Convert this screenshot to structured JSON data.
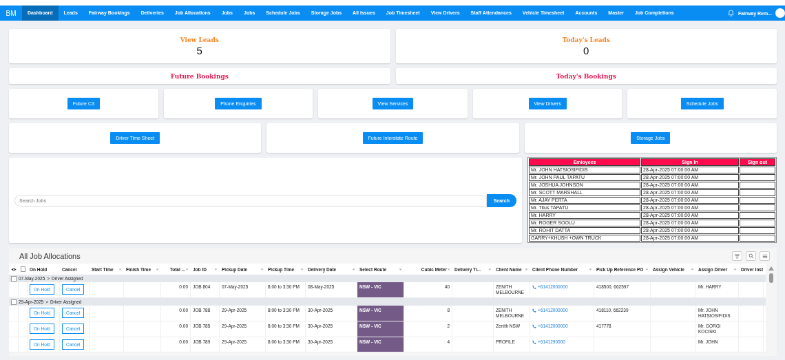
{
  "nav": {
    "brand": "BM",
    "user": "Fairway Rem...",
    "items": [
      {
        "label": "Dashboard",
        "selected": true
      },
      {
        "label": "Leads",
        "selected": false
      },
      {
        "label": "Fairway Bookings",
        "selected": false
      },
      {
        "label": "Deliveries",
        "selected": false
      },
      {
        "label": "Job Allocations",
        "selected": false
      },
      {
        "label": "Jobs",
        "selected": false
      },
      {
        "label": "Jobs",
        "selected": false
      },
      {
        "label": "Schedule Jobs",
        "selected": false
      },
      {
        "label": "Storage Jobs",
        "selected": false
      },
      {
        "label": "All Issues",
        "selected": false
      },
      {
        "label": "Job Timesheet",
        "selected": false
      },
      {
        "label": "View Drivers",
        "selected": false
      },
      {
        "label": "Staff Attendances",
        "selected": false
      },
      {
        "label": "Vehicle Timesheet",
        "selected": false
      },
      {
        "label": "Accounts",
        "selected": false
      },
      {
        "label": "Master",
        "selected": false
      },
      {
        "label": "Job Completions",
        "selected": false
      }
    ]
  },
  "stats": [
    {
      "title": "View Leads",
      "value": "5"
    },
    {
      "title": "Today's Leads",
      "value": "0"
    }
  ],
  "bookings": [
    "Future Bookings",
    "Today's Bookings"
  ],
  "quick_links": [
    [
      "Future C3",
      "Phone Enquiries",
      "View Services",
      "View Drivers",
      "Schedule Jobs"
    ],
    [
      "Driver Time Sheet",
      "Future Interstate Route",
      "Storage Jobs"
    ]
  ],
  "search": {
    "placeholder": "Search Jobs",
    "button": "Search"
  },
  "attendance": {
    "columns": [
      "Emloyees",
      "Sign In",
      "Sign out"
    ],
    "rows": [
      {
        "employee": "Mr. JOHN HATSIOSIFIDIS",
        "sign_in": "28-Apr-2025 07:00:00 AM"
      },
      {
        "employee": "Mr. JOHN PAUL TAPATU",
        "sign_in": "28-Apr-2025 07:00:00 AM"
      },
      {
        "employee": "Mr. JOSHUA JOHNSON",
        "sign_in": "28-Apr-2025 07:00:00 AM"
      },
      {
        "employee": "Mr. SCOTT MARSHALL",
        "sign_in": "28-Apr-2025 07:00:00 AM"
      },
      {
        "employee": "Mr. AJAY PERTA",
        "sign_in": "28-Apr-2025 07:00:00 AM"
      },
      {
        "employee": "Mr. Titus TAPATU",
        "sign_in": "28-Apr-2025 07:00:00 AM"
      },
      {
        "employee": "Mr. HARRY",
        "sign_in": "28-Apr-2025 07:00:00 AM"
      },
      {
        "employee": "Mr. ROGER SOOLU",
        "sign_in": "28-Apr-2025 07:00:00 AM"
      },
      {
        "employee": "Mr. ROHIT DATTA",
        "sign_in": "28-Apr-2025 07:00:00 AM"
      },
      {
        "employee": "GARRY+KHUSH +OWN TRUCK",
        "sign_in": "28-Apr-2025 07:00:00 AM"
      }
    ]
  },
  "jobs": {
    "title": "All Job Allocations",
    "select_all_checked": false,
    "columns": [
      "On Hold",
      "Cancel",
      "Start Time",
      "Finish Time",
      "Total ...",
      "Job ID",
      "Pickup Date",
      "Pickup Time",
      "Delivery Date",
      "Select Route",
      "Cubic Meter",
      "Delivery Ti...",
      "Client Name",
      "Client Phone Number",
      "Pick Up Reference PO",
      "Assign Vehicle",
      "Assign Driver",
      "Driver Inst"
    ],
    "groups": [
      {
        "date": "07-May-2025",
        "separator": ">",
        "status": "Driver Assigned",
        "checked": false,
        "rows": [
          {
            "on_hold": "On Hold",
            "cancel": "Cancel",
            "total": "0.00",
            "job_id": "JOB 804",
            "pickup_date": "07-May-2025",
            "pickup_time": "8:00 to 3:30 PM",
            "delivery_date": "08-May-2025",
            "route": "NSW - VIC",
            "cubic_meter": "40",
            "client_name": "ZENITH MELBOURNE",
            "client_phone": "+61412000000",
            "pickup_reference_po": "418500, 662597",
            "assign_driver": "Mr. HARRY"
          }
        ]
      },
      {
        "date": "29-Apr-2025",
        "separator": ">",
        "status": "Driver Assigned",
        "checked": false,
        "rows": [
          {
            "on_hold": "On Hold",
            "cancel": "Cancel",
            "total": "0.00",
            "job_id": "JOB 788",
            "pickup_date": "29-Apr-2025",
            "pickup_time": "8:00 to 3:30 PM",
            "delivery_date": "30-Apr-2025",
            "route": "NSW - VIC",
            "cubic_meter": "8",
            "client_name": "ZENITH MELBOURNE",
            "client_phone": "+61412000000",
            "pickup_reference_po": "418110, 662239",
            "assign_driver": "Mr. JOHN HATSIOSIFIDIS"
          },
          {
            "on_hold": "On Hold",
            "cancel": "Cancel",
            "total": "0.00",
            "job_id": "JOB 785",
            "pickup_date": "29-Apr-2025",
            "pickup_time": "8:00 to 3:30 PM",
            "delivery_date": "30-Apr-2025",
            "route": "NSW - VIC",
            "cubic_meter": "2",
            "client_name": "Zenith NSW",
            "client_phone": "+61412000000",
            "pickup_reference_po": "417778",
            "assign_driver": "Mr. GORGI KOCISKI"
          },
          {
            "on_hold": "On Hold",
            "cancel": "Cancel",
            "total": "0.00",
            "job_id": "JOB 789",
            "pickup_date": "29-Apr-2025",
            "pickup_time": "8:00 to 3:30 PM",
            "delivery_date": "30-Apr-2025",
            "route": "NSW - VIC",
            "cubic_meter": "4",
            "client_name": "PROFILE",
            "client_phone": "+6141290000",
            "assign_driver": "Mr. JOHN"
          }
        ]
      }
    ]
  }
}
